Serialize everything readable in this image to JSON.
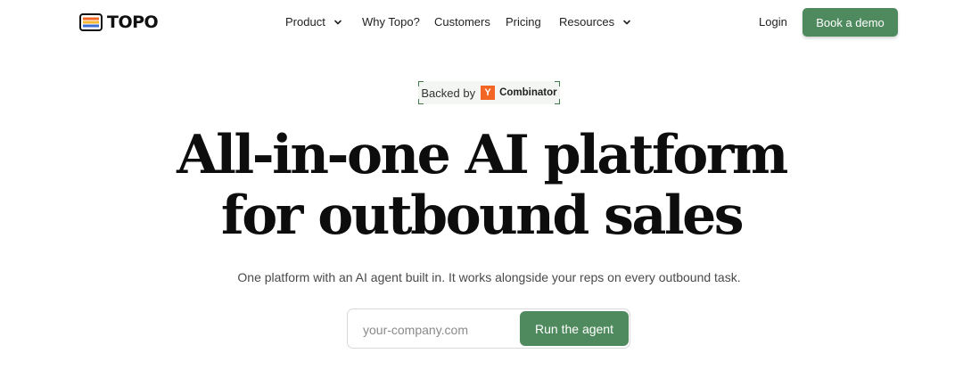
{
  "brand": {
    "name": "TOPO",
    "logo_colors": [
      "#f26522",
      "#f7b733",
      "#3b6fd6"
    ]
  },
  "nav": {
    "items": [
      {
        "label": "Product",
        "has_dropdown": true
      },
      {
        "label": "Why Topo?",
        "has_dropdown": false
      },
      {
        "label": "Customers",
        "has_dropdown": false
      },
      {
        "label": "Pricing",
        "has_dropdown": false
      },
      {
        "label": "Resources",
        "has_dropdown": true
      }
    ],
    "login_label": "Login",
    "cta_label": "Book a demo"
  },
  "badge": {
    "prefix": "Backed by",
    "logo_letter": "Y",
    "logo_text": "Combinator"
  },
  "hero": {
    "headline_line1": "All-in-one AI platform",
    "headline_line2": "for outbound sales",
    "subheading": "One platform with an AI agent built in. It works alongside your reps on every outbound task."
  },
  "form": {
    "placeholder": "your-company.com",
    "value": "",
    "button_label": "Run the agent"
  },
  "colors": {
    "accent": "#4f8a5e",
    "yc_orange": "#f26522",
    "badge_bg": "#f3f6f3"
  }
}
